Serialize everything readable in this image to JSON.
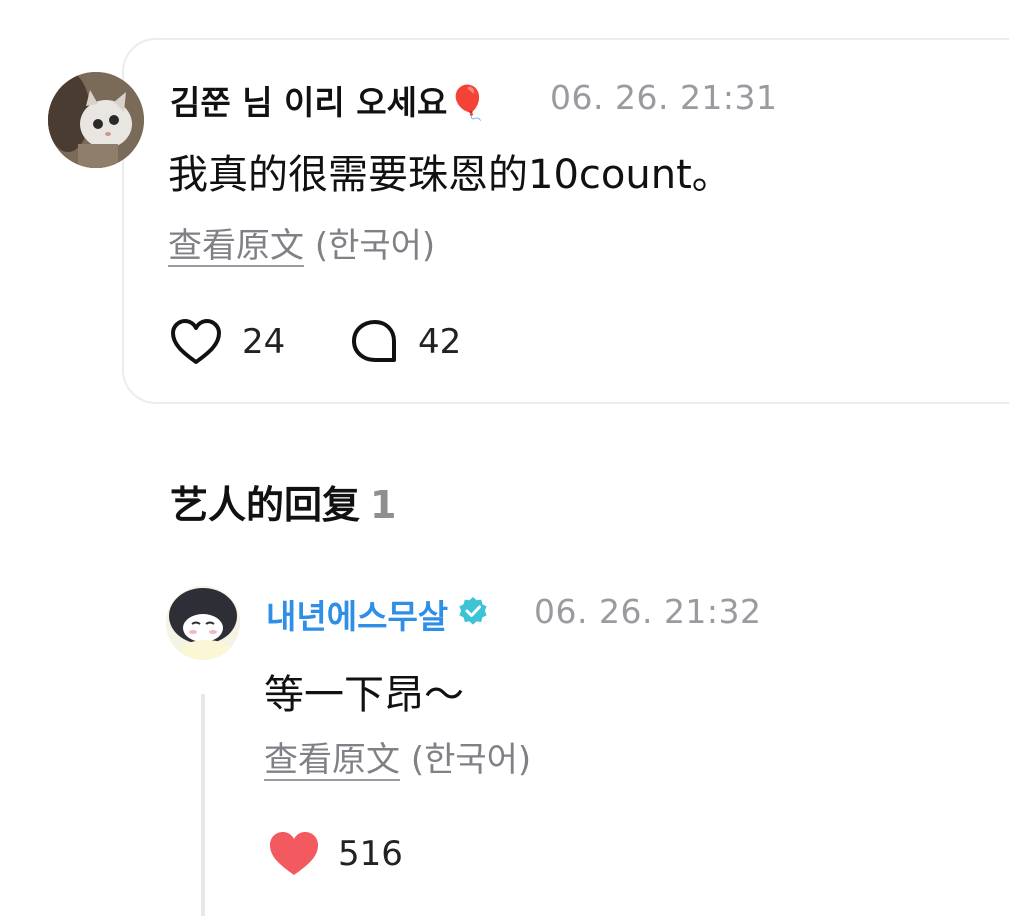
{
  "comment": {
    "author": "김쭌 님 이리 오세요🎈",
    "timestamp": "06. 26. 21:31",
    "text": "我真的很需要珠恩的10count。",
    "view_original": "查看原文",
    "original_language": "(한국어)",
    "like_count": "24",
    "reply_count": "42"
  },
  "artist_replies": {
    "title": "艺人的回复",
    "count": "1",
    "reply": {
      "author": "내년에스무살",
      "verified": true,
      "timestamp": "06. 26. 21:32",
      "text": "等一下昂～",
      "view_original": "查看原文",
      "original_language": "(한국어)",
      "like_count": "516",
      "liked": true
    }
  },
  "icons": {
    "like_outline": "heart-outline-icon",
    "reply": "speech-bubble-icon",
    "like_filled": "heart-filled-icon",
    "verified": "verified-badge-icon"
  },
  "colors": {
    "artist_name": "#2f8fe6",
    "verified_badge": "#3cc3d6",
    "liked_heart": "#f25a5f",
    "timestamp": "#9a9aa0"
  }
}
